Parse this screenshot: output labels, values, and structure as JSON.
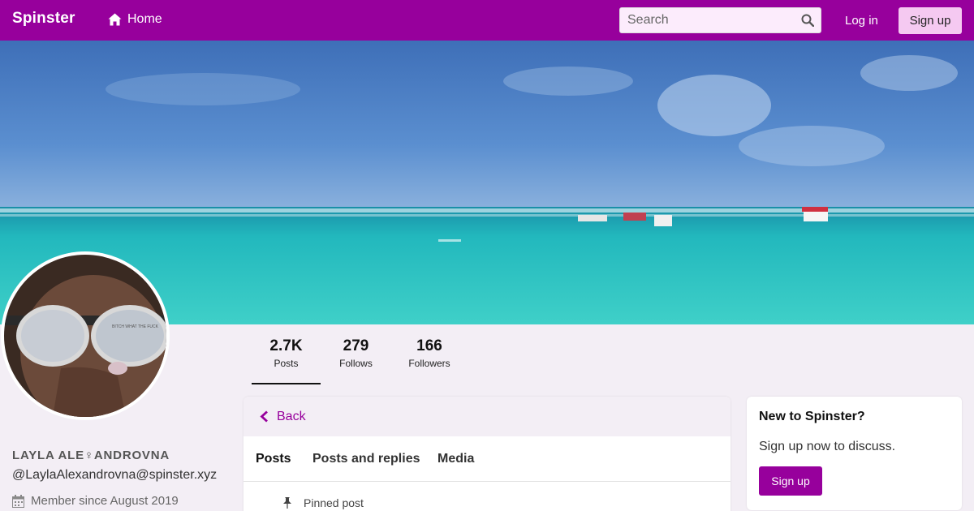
{
  "nav": {
    "brand": "Spinster",
    "home_label": "Home",
    "search_placeholder": "Search",
    "login_label": "Log in",
    "signup_label": "Sign up"
  },
  "profile": {
    "display_name": "LAYLA ALE♀ANDROVNA",
    "handle": "@LaylaAlexandrovna@spinster.xyz",
    "member_since": "Member since August 2019",
    "avatar_sunglasses_text": "BITCH WHAT THE FUCK"
  },
  "stats": [
    {
      "value": "2.7K",
      "label": "Posts"
    },
    {
      "value": "279",
      "label": "Follows"
    },
    {
      "value": "166",
      "label": "Followers"
    }
  ],
  "timeline": {
    "back_label": "Back",
    "tabs": [
      {
        "label": "Posts",
        "active": true
      },
      {
        "label": "Posts and replies",
        "active": false
      },
      {
        "label": "Media",
        "active": false
      }
    ],
    "pinned_label": "Pinned post"
  },
  "sidebar": {
    "title": "New to Spinster?",
    "text": "Sign up now to discuss.",
    "button_label": "Sign up"
  },
  "colors": {
    "brand_purple": "#97009c",
    "signup_pink": "#f5c9f1",
    "page_bg": "#f3eef5"
  }
}
